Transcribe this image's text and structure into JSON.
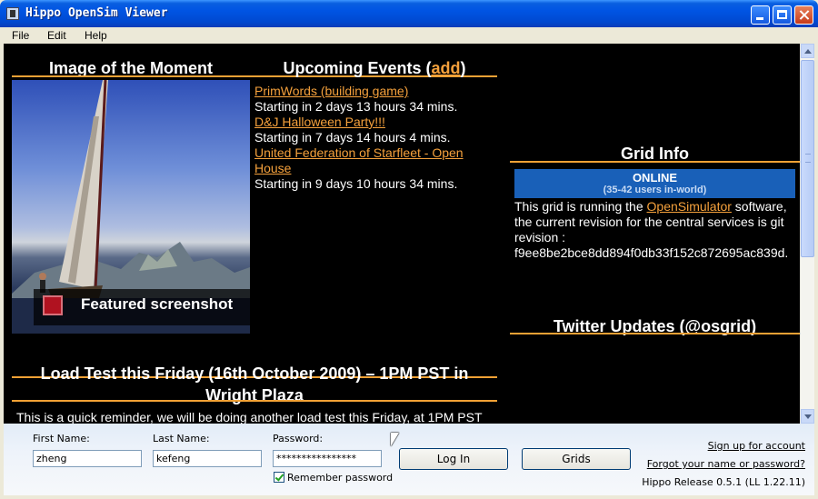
{
  "window": {
    "title": "Hippo OpenSim Viewer"
  },
  "menu": [
    "File",
    "Edit",
    "Help"
  ],
  "colors": {
    "accent": "#f1a135",
    "link": "#f5a13c",
    "online_bg": "#1960b8",
    "content_bg": "#000000"
  },
  "moment": {
    "heading": "Image of the Moment",
    "featured_label": "Featured screenshot"
  },
  "events": {
    "heading": "Upcoming Events (",
    "add_link": "add",
    "heading_end": ")",
    "items": [
      {
        "name": "PrimWords (building game)",
        "time": "Starting in 2 days 13 hours 34 mins."
      },
      {
        "name": "D&J Halloween Party!!!",
        "time": "Starting in 7 days 14 hours 4 mins."
      },
      {
        "name": "United Federation of Starfleet - Open House",
        "time": "Starting in 9 days 10 hours 34 mins."
      }
    ]
  },
  "grid": {
    "heading": "Grid Info",
    "status": "ONLINE",
    "users": "(35-42 users in-world)",
    "desc_pre": "This grid is running the ",
    "desc_link": "OpenSimulator",
    "desc_post": " software, the current revision for the central services is git revision : f9ee8be2bce8dd894f0db33f152c872695ac839d."
  },
  "twitter": {
    "heading": "Twitter Updates (@osgrid)"
  },
  "news": {
    "heading": "Load Test this Friday (16th October 2009) – 1PM PST in Wright Plaza",
    "snippet": "This is a quick reminder, we will be doing another load test this Friday, at 1PM PST"
  },
  "login": {
    "first_name_label": "First Name:",
    "first_name_value": "zheng",
    "last_name_label": "Last Name:",
    "last_name_value": "kefeng",
    "password_label": "Password:",
    "password_value": "****************",
    "remember_label": "Remember password",
    "remember_checked": true,
    "login_button": "Log In",
    "grids_button": "Grids",
    "signup_link": "Sign up for account",
    "forgot_link": "Forgot your name or password?",
    "release": "Hippo Release 0.5.1 (LL 1.22.11)"
  }
}
